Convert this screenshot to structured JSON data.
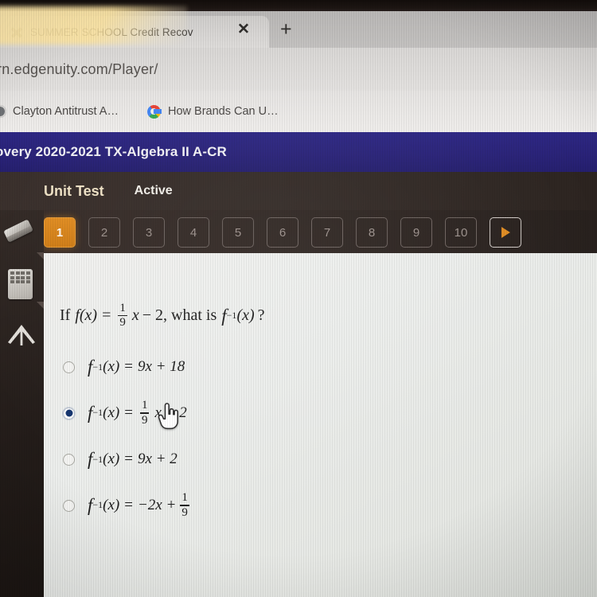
{
  "browser": {
    "tab": {
      "title": "SUMMER SCHOOL Credit Recove",
      "favicon": "x-favicon",
      "close_label": "✕",
      "new_tab_label": "+"
    },
    "url": "rn.edgenuity.com/Player/",
    "bookmarks": [
      {
        "label": "Clayton Antitrust A…",
        "icon": "globe-icon"
      },
      {
        "label": "How Brands Can U…",
        "icon": "google-icon"
      }
    ]
  },
  "app": {
    "course_title": "overy 2020-2021 TX-Algebra II A-CR",
    "assignment_type": "Unit Test",
    "assignment_status": "Active",
    "question_nav": {
      "items": [
        "1",
        "2",
        "3",
        "4",
        "5",
        "6",
        "7",
        "8",
        "9",
        "10"
      ],
      "current": "1",
      "next_label": "next-arrow-icon"
    },
    "tools": [
      {
        "name": "eraser-icon"
      },
      {
        "name": "calculator-icon"
      },
      {
        "name": "arrow-up-icon"
      }
    ]
  },
  "question": {
    "stem": {
      "prefix": "If",
      "fn": "f",
      "fn_arg": "(x)",
      "equals": "=",
      "coef_num": "1",
      "coef_den": "9",
      "var": "x",
      "const": "− 2",
      "mid": ", what is",
      "inv_fn": "f",
      "inv_sup": "−1",
      "inv_arg": "(x)",
      "qmark": "?"
    },
    "options": [
      {
        "id": "A",
        "selected": false,
        "lhs_fn": "f",
        "lhs_sup": "−1",
        "lhs_arg": "(x)",
        "eq": "=",
        "rhs": "9x + 18",
        "rhs_kind": "plain"
      },
      {
        "id": "B",
        "selected": true,
        "lhs_fn": "f",
        "lhs_sup": "−1",
        "lhs_arg": "(x)",
        "eq": "=",
        "rhs_kind": "lead-fraction",
        "frac_num": "1",
        "frac_den": "9",
        "rhs_tail": "x + 2"
      },
      {
        "id": "C",
        "selected": false,
        "lhs_fn": "f",
        "lhs_sup": "−1",
        "lhs_arg": "(x)",
        "eq": "=",
        "rhs": "9x + 2",
        "rhs_kind": "plain"
      },
      {
        "id": "D",
        "selected": false,
        "lhs_fn": "f",
        "lhs_sup": "−1",
        "lhs_arg": "(x)",
        "eq": "=",
        "rhs_kind": "trail-fraction",
        "rhs_head": "−2x +",
        "frac_num": "1",
        "frac_den": "9"
      }
    ]
  },
  "cursor": {
    "type": "pointing-hand-cursor"
  },
  "colors": {
    "course_bar_blue": "#2a2379",
    "current_question_orange": "#d4821f",
    "selected_radio_blue": "#14346f",
    "assignment_label_cream": "#efe2c6"
  }
}
